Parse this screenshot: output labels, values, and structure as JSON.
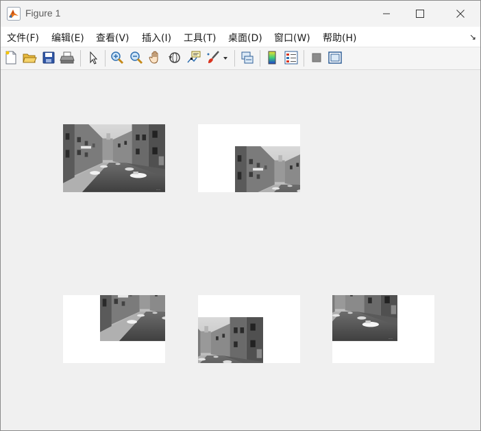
{
  "window": {
    "title": "Figure 1",
    "icon": "matlab-logo-icon",
    "controls": [
      "minimize-icon",
      "maximize-icon",
      "close-icon"
    ]
  },
  "menu": {
    "items": [
      {
        "label": "文件(F)"
      },
      {
        "label": "编辑(E)"
      },
      {
        "label": "查看(V)"
      },
      {
        "label": "插入(I)"
      },
      {
        "label": "工具(T)"
      },
      {
        "label": "桌面(D)"
      },
      {
        "label": "窗口(W)"
      },
      {
        "label": "帮助(H)"
      }
    ],
    "corner_glyph": "↘"
  },
  "toolbar": {
    "tools": [
      "new-figure-icon",
      "open-file-icon",
      "save-icon",
      "print-icon",
      "select-arrow-icon",
      "zoom-in-icon",
      "zoom-out-icon",
      "pan-hand-icon",
      "rotate-3d-icon",
      "data-cursor-icon",
      "brush-icon",
      "brush-dropdown-icon",
      "link-plot-icon",
      "colorbar-icon",
      "legend-icon",
      "hide-plot-tools-icon",
      "show-plot-tools-icon"
    ]
  },
  "figure": {
    "subplots": [
      {
        "name": "subplot-1",
        "content": "original canal photo, grayscale",
        "image_fill": "full"
      },
      {
        "name": "subplot-2",
        "content": "canal photo shifted right and down",
        "image_fill": "shifted"
      },
      {
        "name": "subplot-3",
        "content": "canal photo shifted right and up",
        "image_fill": "shifted"
      },
      {
        "name": "subplot-4",
        "content": "canal photo shifted left and down",
        "image_fill": "shifted"
      },
      {
        "name": "subplot-5",
        "content": "canal photo shifted left and up",
        "image_fill": "shifted"
      }
    ]
  }
}
